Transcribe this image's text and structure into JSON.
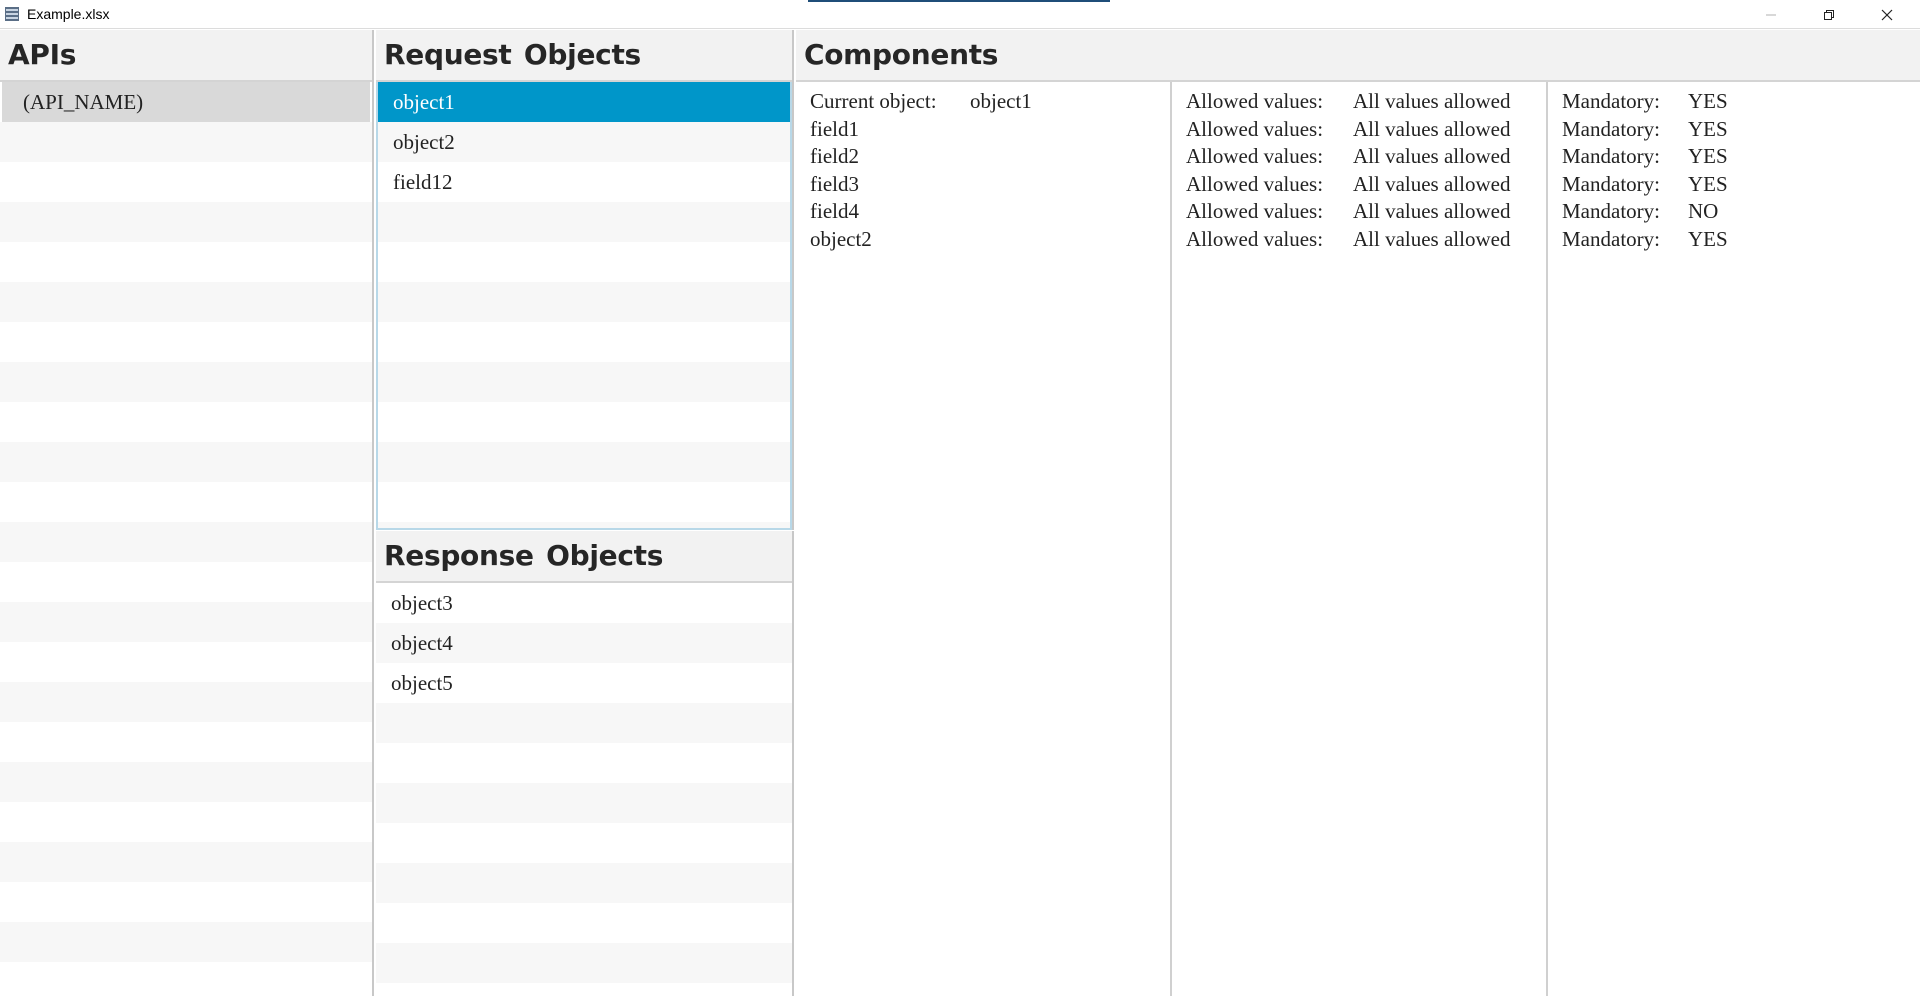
{
  "window": {
    "title": "Example.xlsx",
    "icon": "spreadsheet-app-icon",
    "controls": [
      "minimize",
      "restore",
      "close"
    ]
  },
  "apis": {
    "header": "APIs",
    "items": [
      {
        "label": "(API_NAME)",
        "active": true
      }
    ]
  },
  "request_objects": {
    "header": "Request Objects",
    "items": [
      {
        "label": "object1",
        "selected": true
      },
      {
        "label": "object2",
        "selected": false
      },
      {
        "label": "field12",
        "selected": false
      }
    ]
  },
  "response_objects": {
    "header": "Response Objects",
    "items": [
      {
        "label": "object3"
      },
      {
        "label": "object4"
      },
      {
        "label": "object5"
      }
    ]
  },
  "components": {
    "header": "Components",
    "current_object_label": "Current object:",
    "current_object_value": "object1",
    "allowed_label": "Allowed values:",
    "mandatory_label": "Mandatory:",
    "rows": [
      {
        "name": "field1",
        "allowed": "All values allowed",
        "mandatory": "YES"
      },
      {
        "name": "field2",
        "allowed": "All values allowed",
        "mandatory": "YES"
      },
      {
        "name": "field3",
        "allowed": "All values allowed",
        "mandatory": "YES"
      },
      {
        "name": "field4",
        "allowed": "All values allowed",
        "mandatory": "NO"
      },
      {
        "name": "object2",
        "allowed": "All values allowed",
        "mandatory": "YES"
      }
    ],
    "first_row": {
      "allowed": "All values allowed",
      "mandatory": "YES"
    }
  },
  "colors": {
    "selection": "#0096c9",
    "header_bg": "#f2f2f2",
    "stripe": "#f7f7f7",
    "active_row": "#d9d9d9"
  }
}
